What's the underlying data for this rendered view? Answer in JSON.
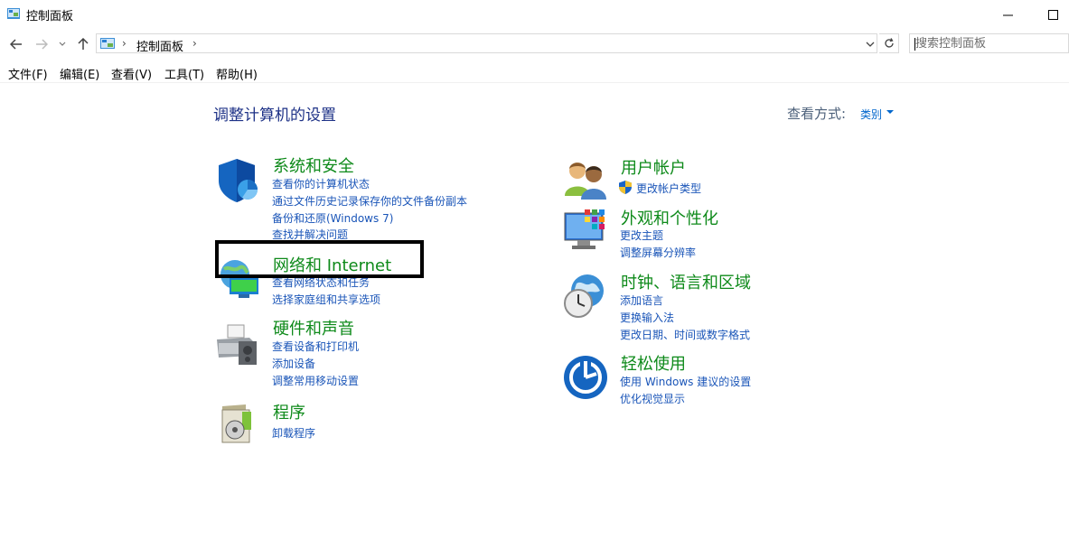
{
  "window": {
    "title": "控制面板",
    "minimize_glyph": "─",
    "maximize_glyph": "☐"
  },
  "address_bar": {
    "breadcrumb": "控制面板",
    "separator": "›",
    "search_placeholder": "搜索控制面板"
  },
  "menu": [
    "文件(F)",
    "编辑(E)",
    "查看(V)",
    "工具(T)",
    "帮助(H)"
  ],
  "main": {
    "heading": "调整计算机的设置",
    "view_by_label": "查看方式:",
    "view_by_value": "类别"
  },
  "categories": [
    {
      "title": "系统和安全",
      "icon": "shield-icon",
      "links": [
        "查看你的计算机状态",
        "通过文件历史记录保存你的文件备份副本",
        "备份和还原(Windows 7)",
        "查找并解决问题"
      ]
    },
    {
      "title": "网络和 Internet",
      "icon": "network-icon",
      "links": [
        "查看网络状态和任务",
        "选择家庭组和共享选项"
      ]
    },
    {
      "title": "硬件和声音",
      "icon": "printer-icon",
      "links": [
        "查看设备和打印机",
        "添加设备",
        "调整常用移动设置"
      ]
    },
    {
      "title": "程序",
      "icon": "programs-icon",
      "links": [
        "卸载程序"
      ]
    },
    {
      "title": "用户帐户",
      "icon": "users-icon",
      "links": [
        "更改帐户类型"
      ]
    },
    {
      "title": "外观和个性化",
      "icon": "appearance-icon",
      "links": [
        "更改主题",
        "调整屏幕分辨率"
      ]
    },
    {
      "title": "时钟、语言和区域",
      "icon": "clock-globe-icon",
      "links": [
        "添加语言",
        "更换输入法",
        "更改日期、时间或数字格式"
      ]
    },
    {
      "title": "轻松使用",
      "icon": "ease-of-access-icon",
      "links": [
        "使用 Windows 建议的设置",
        "优化视觉显示"
      ]
    }
  ],
  "colors": {
    "category_title": "#0e8a1a",
    "link": "#1a55b8",
    "heading": "#1e3287",
    "highlight_border": "#000000"
  }
}
